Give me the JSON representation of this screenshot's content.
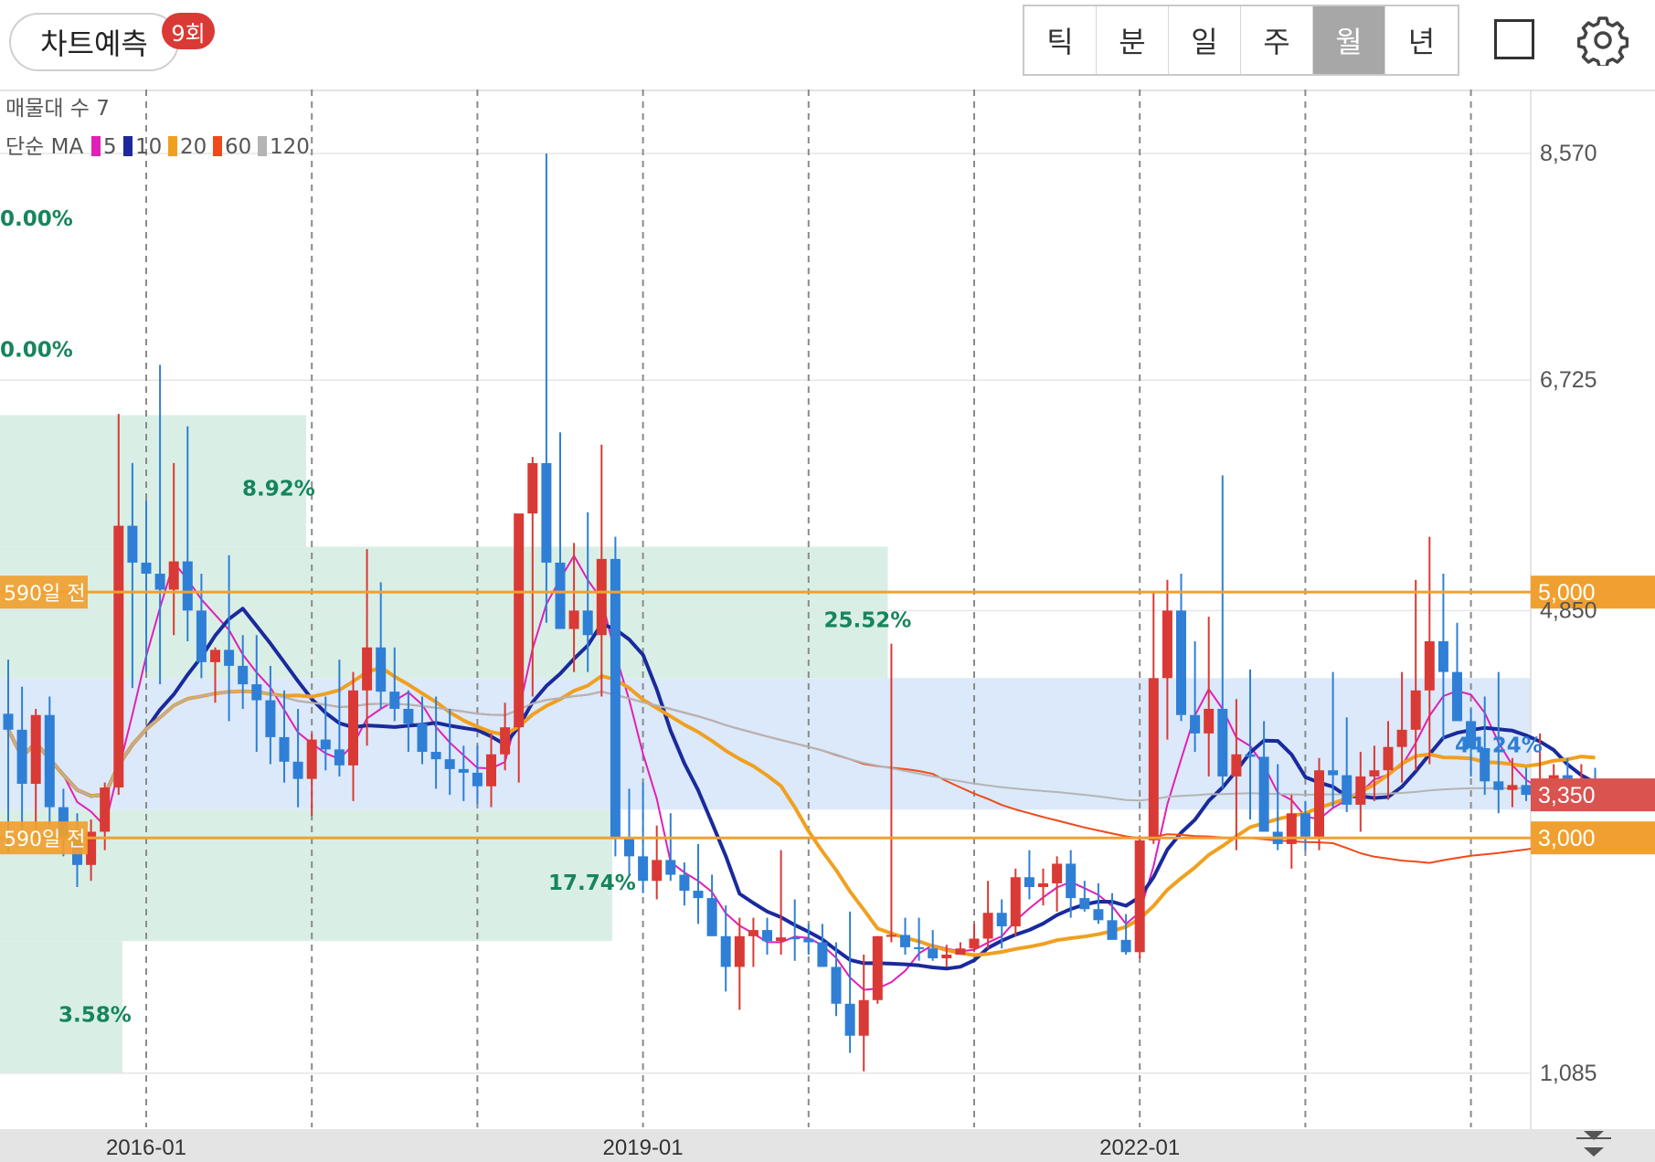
{
  "toolbar": {
    "predict_label": "차트예측",
    "predict_badge": "9회",
    "tabs": [
      {
        "label": "틱",
        "active": false
      },
      {
        "label": "분",
        "active": false
      },
      {
        "label": "일",
        "active": false
      },
      {
        "label": "주",
        "active": false
      },
      {
        "label": "월",
        "active": true
      },
      {
        "label": "년",
        "active": false
      }
    ],
    "icons": [
      "square-icon",
      "gear-icon"
    ]
  },
  "legend": {
    "volume_profile": "매물대 수 7",
    "ma_title": "단순 MA",
    "ma": [
      {
        "period": "5",
        "color": "#e020b8"
      },
      {
        "period": "10",
        "color": "#1a2a9c"
      },
      {
        "period": "20",
        "color": "#f0a020"
      },
      {
        "period": "60",
        "color": "#f04a1a"
      },
      {
        "period": "120",
        "color": "#b4b4b4"
      }
    ]
  },
  "colors": {
    "up": "#d93a35",
    "down": "#2f7fd6",
    "highlight_line": "#f0a030",
    "price_tag": "#d9534f",
    "profile_green": "#d9efe6",
    "profile_blue": "#dbe9fa"
  },
  "chart_data": {
    "type": "candlestick",
    "interval": "monthly",
    "title": "",
    "y_ticks": [
      {
        "label": "8,570",
        "value": 8570
      },
      {
        "label": "6,725",
        "value": 6725
      },
      {
        "label": "4,850",
        "value": 4850
      },
      {
        "label": "1,085",
        "value": 1085
      }
    ],
    "ylim": [
      630,
      9090
    ],
    "x_ticks": [
      "2016-01",
      "2019-01",
      "2022-01"
    ],
    "start_month": "2015-03",
    "current_price": {
      "label": "3,350",
      "value": 3350
    },
    "highlight_lines": [
      {
        "value": 5000,
        "label_right": "5,000",
        "label_left": "590일 전"
      },
      {
        "value": 3000,
        "label_right": "3,000",
        "label_left": "590일 전"
      }
    ],
    "volume_profile": [
      {
        "from": 1085,
        "to": 2160,
        "pct": "3.58%",
        "bar_extent": 0.08,
        "color": "green"
      },
      {
        "from": 2160,
        "to": 3230,
        "pct": "17.74%",
        "bar_extent": 0.4,
        "color": "green"
      },
      {
        "from": 3230,
        "to": 4300,
        "pct": "44.24%",
        "bar_extent": 1.0,
        "color": "blue"
      },
      {
        "from": 4300,
        "to": 5370,
        "pct": "25.52%",
        "bar_extent": 0.58,
        "color": "green"
      },
      {
        "from": 5370,
        "to": 6440,
        "pct": "8.92%",
        "bar_extent": 0.2,
        "color": "green"
      },
      {
        "from": 6440,
        "to": 7510,
        "pct": "0.00%",
        "bar_extent": 0,
        "color": "green"
      },
      {
        "from": 7510,
        "to": 8570,
        "pct": "0.00%",
        "bar_extent": 0,
        "color": "green"
      }
    ],
    "candles": [
      [
        4010,
        4450,
        2880,
        3880
      ],
      [
        3880,
        4230,
        3050,
        3440
      ],
      [
        3440,
        4050,
        3000,
        4000
      ],
      [
        4000,
        4150,
        3100,
        3250
      ],
      [
        3250,
        3400,
        2850,
        2990
      ],
      [
        2990,
        3200,
        2600,
        2780
      ],
      [
        2780,
        3150,
        2650,
        3050
      ],
      [
        3050,
        3450,
        2900,
        3410
      ],
      [
        3410,
        6450,
        3350,
        5540
      ],
      [
        5540,
        6050,
        4220,
        5240
      ],
      [
        5240,
        5750,
        4350,
        5150
      ],
      [
        5150,
        6850,
        4250,
        5020
      ],
      [
        5020,
        6050,
        4650,
        5250
      ],
      [
        5250,
        6350,
        4600,
        4850
      ],
      [
        4850,
        5150,
        4300,
        4430
      ],
      [
        4430,
        4550,
        4100,
        4530
      ],
      [
        4530,
        5300,
        3950,
        4400
      ],
      [
        4400,
        4650,
        4050,
        4250
      ],
      [
        4250,
        4650,
        3700,
        4120
      ],
      [
        4120,
        4400,
        3600,
        3820
      ],
      [
        3820,
        4200,
        3450,
        3620
      ],
      [
        3620,
        4050,
        3250,
        3480
      ],
      [
        3480,
        3850,
        3180,
        3800
      ],
      [
        3800,
        4150,
        3550,
        3720
      ],
      [
        3720,
        4450,
        3500,
        3590
      ],
      [
        3590,
        4350,
        3300,
        4200
      ],
      [
        4200,
        5350,
        3750,
        4550
      ],
      [
        4550,
        5080,
        4050,
        4190
      ],
      [
        4190,
        4550,
        3950,
        4050
      ],
      [
        4050,
        4200,
        3700,
        3930
      ],
      [
        3930,
        4150,
        3600,
        3700
      ],
      [
        3700,
        4150,
        3400,
        3640
      ],
      [
        3640,
        4050,
        3350,
        3560
      ],
      [
        3560,
        3750,
        3300,
        3530
      ],
      [
        3530,
        3750,
        3280,
        3420
      ],
      [
        3420,
        3850,
        3250,
        3680
      ],
      [
        3680,
        4100,
        3550,
        3900
      ],
      [
        3900,
        5250,
        3450,
        5640
      ],
      [
        5640,
        6100,
        4150,
        6050
      ],
      [
        6050,
        8570,
        4750,
        5240
      ],
      [
        5240,
        6300,
        4750,
        4700
      ],
      [
        4700,
        5400,
        4350,
        4850
      ],
      [
        4850,
        5650,
        4350,
        4650
      ],
      [
        4650,
        6200,
        4150,
        5270
      ],
      [
        5270,
        5450,
        2850,
        3000
      ],
      [
        3000,
        3400,
        2700,
        2850
      ],
      [
        2850,
        3450,
        2550,
        2650
      ],
      [
        2650,
        3100,
        2500,
        2820
      ],
      [
        2820,
        3200,
        2650,
        2700
      ],
      [
        2700,
        2800,
        2450,
        2570
      ],
      [
        2570,
        2950,
        2300,
        2510
      ],
      [
        2510,
        2700,
        2200,
        2200
      ],
      [
        2200,
        2450,
        1750,
        1950
      ],
      [
        1950,
        2350,
        1600,
        2200
      ],
      [
        2200,
        2350,
        1950,
        2250
      ],
      [
        2250,
        2350,
        2050,
        2160
      ],
      [
        2160,
        2900,
        2050,
        2190
      ],
      [
        2190,
        2500,
        2000,
        2180
      ],
      [
        2180,
        2300,
        2050,
        2150
      ],
      [
        2150,
        2300,
        1950,
        1950
      ],
      [
        1950,
        2150,
        1550,
        1650
      ],
      [
        1650,
        2400,
        1250,
        1390
      ],
      [
        1390,
        2050,
        1100,
        1680
      ],
      [
        1680,
        2200,
        1650,
        2200
      ],
      [
        2200,
        4580,
        2150,
        2210
      ],
      [
        2210,
        2350,
        2050,
        2110
      ],
      [
        2110,
        2350,
        2000,
        2100
      ],
      [
        2100,
        2250,
        2000,
        2020
      ],
      [
        2020,
        2130,
        1950,
        2050
      ],
      [
        2050,
        2150,
        2050,
        2100
      ],
      [
        2100,
        2300,
        2070,
        2180
      ],
      [
        2180,
        2650,
        2100,
        2390
      ],
      [
        2390,
        2500,
        2100,
        2280
      ],
      [
        2280,
        2750,
        2200,
        2680
      ],
      [
        2680,
        2900,
        2500,
        2600
      ],
      [
        2600,
        2750,
        2450,
        2630
      ],
      [
        2630,
        2850,
        2400,
        2790
      ],
      [
        2790,
        2900,
        2350,
        2510
      ],
      [
        2510,
        2650,
        2400,
        2420
      ],
      [
        2420,
        2630,
        2300,
        2330
      ],
      [
        2330,
        2550,
        2200,
        2170
      ],
      [
        2170,
        2380,
        2050,
        2070
      ],
      [
        2070,
        3020,
        2020,
        2980
      ],
      [
        2980,
        5000,
        2950,
        4300
      ],
      [
        4300,
        5100,
        3800,
        4850
      ],
      [
        4850,
        5150,
        3950,
        4000
      ],
      [
        4000,
        4600,
        3700,
        3850
      ],
      [
        3850,
        4800,
        3500,
        4050
      ],
      [
        4050,
        5950,
        3400,
        3500
      ],
      [
        3500,
        4130,
        2900,
        3680
      ],
      [
        3680,
        4370,
        3150,
        3660
      ],
      [
        3660,
        3950,
        3050,
        3050
      ],
      [
        3050,
        3600,
        2900,
        2950
      ],
      [
        2950,
        3350,
        2750,
        3200
      ],
      [
        3200,
        3300,
        2900,
        3010
      ],
      [
        3010,
        3650,
        2900,
        3550
      ],
      [
        3550,
        4350,
        3250,
        3510
      ],
      [
        3510,
        3980,
        3210,
        3270
      ],
      [
        3270,
        3700,
        3050,
        3500
      ],
      [
        3500,
        3750,
        3300,
        3550
      ],
      [
        3550,
        3950,
        3310,
        3740
      ],
      [
        3740,
        4350,
        3450,
        3880
      ],
      [
        3880,
        5100,
        3550,
        4200
      ],
      [
        4200,
        5450,
        3600,
        4600
      ],
      [
        4600,
        5150,
        3800,
        4350
      ],
      [
        4350,
        4750,
        3950,
        3950
      ],
      [
        3950,
        4050,
        3500,
        3730
      ],
      [
        3730,
        4150,
        3350,
        3460
      ],
      [
        3460,
        4350,
        3200,
        3390
      ],
      [
        3390,
        3650,
        3250,
        3430
      ],
      [
        3430,
        3570,
        3300,
        3350
      ],
      [
        3350,
        3850,
        3270,
        3380
      ],
      [
        3380,
        3600,
        3260,
        3510
      ],
      [
        3510,
        3650,
        3300,
        3430
      ],
      [
        3430,
        3600,
        3300,
        3470
      ],
      [
        3470,
        3570,
        3360,
        3350
      ]
    ]
  }
}
